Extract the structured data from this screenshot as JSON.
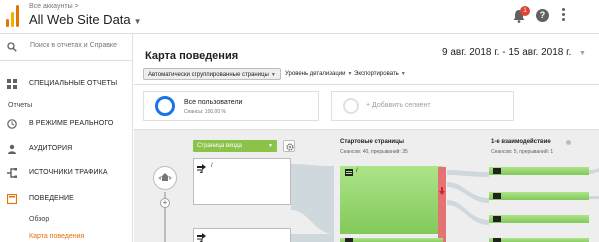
{
  "header": {
    "account_small": "Все аккаунты >",
    "account_name": "All Web Site Data",
    "notification_count": "1",
    "help_glyph": "?",
    "icons": [
      "analytics-logo",
      "bell-icon",
      "help-icon",
      "kebab-menu-icon"
    ]
  },
  "sidebar": {
    "search_placeholder": "Поиск в отчетах и Справке",
    "custom_reports": "СПЕЦИАЛЬНЫЕ ОТЧЕТЫ",
    "reports_section": "Отчеты",
    "items": [
      {
        "label": "В РЕЖИМЕ РЕАЛЬНОГО",
        "icon": "clock-icon"
      },
      {
        "label": "АУДИТОРИЯ",
        "icon": "person-icon"
      },
      {
        "label": "ИСТОЧНИКИ ТРАФИКА",
        "icon": "acquisition-icon"
      },
      {
        "label": "ПОВЕДЕНИЕ",
        "icon": "behavior-icon"
      }
    ],
    "sub_items": [
      {
        "label": "Обзор",
        "active": false
      },
      {
        "label": "Карта поведения",
        "active": true
      }
    ]
  },
  "main": {
    "title": "Карта поведения",
    "date_range": "9 авг. 2018 г. - 15 авг. 2018 г.",
    "tabs": [
      {
        "label": "Автоматически сгруппированные страницы"
      },
      {
        "label": "Уровень детализации"
      },
      {
        "label": "Экспортировать"
      }
    ],
    "segments": {
      "active_name": "Все пользователи",
      "active_sub": "Сеансы: 100,00 %",
      "add_label": "+ Добавить сегмент"
    },
    "flow": {
      "dimension_dropdown": "Страница входа",
      "col1_title": "Стартовые страницы",
      "col1_sub": "Сеансов: 40, прерываний: 35",
      "col2_title": "1-е взаимодействие",
      "col2_sub": "Сеансов: 5, прерываний: 1",
      "node1_label": "/",
      "green_node_label": "/"
    }
  },
  "colors": {
    "accent_orange": "#e8710a",
    "segment_blue": "#1a73e8",
    "flow_green": "#8bc34a",
    "dropoff_red": "#e57373",
    "badge_red": "#db4437"
  }
}
